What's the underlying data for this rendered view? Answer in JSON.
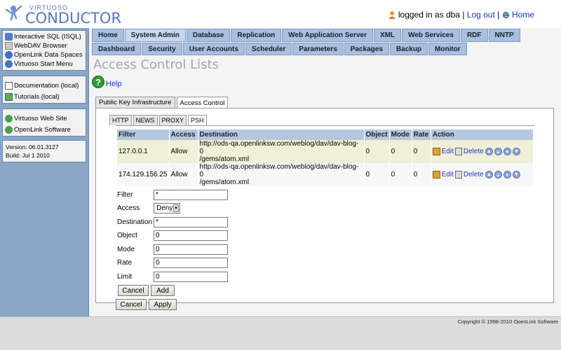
{
  "header": {
    "logo_small": "VIRTUOSO",
    "logo_big": "CONDUCTOR",
    "logged_in": "logged in as dba",
    "separator1": "|",
    "logout": "Log out",
    "separator2": "|",
    "home": "Home"
  },
  "sidebar": {
    "group1": [
      "Interactive SQL (ISQL)",
      "WebDAV Browser",
      "OpenLink Data Spaces",
      "Virtuoso Start Menu"
    ],
    "group2": [
      "Documentation (local)",
      "Tutorials (local)"
    ],
    "group3": [
      "Virtuoso Web Site",
      "OpenLink Software"
    ],
    "version": "Version: 06.01.3127",
    "build": "Build: Jul 1 2010"
  },
  "nav": {
    "tabs": [
      "Home",
      "System Admin",
      "Database",
      "Replication",
      "Web Application Server",
      "XML",
      "Web Services",
      "RDF",
      "NNTP"
    ],
    "active_tab": "System Admin",
    "subtabs": [
      "Dashboard",
      "Security",
      "User Accounts",
      "Scheduler",
      "Parameters",
      "Packages",
      "Backup",
      "Monitor"
    ],
    "active_subtab": "Security"
  },
  "page": {
    "title": "Access Control Lists",
    "help": "Help"
  },
  "outer_tabs": [
    "Public Key Infrastructure",
    "Access Control"
  ],
  "inner_tabs": [
    "HTTP",
    "NEWS",
    "PROXY",
    "PSH"
  ],
  "table": {
    "columns": [
      "Filter",
      "Access",
      "Destination",
      "Object",
      "Mode",
      "Rate",
      "Action"
    ],
    "rows": [
      {
        "filter": "127.0.0.1",
        "access": "Allow",
        "dest1": "http://ods-qa.openlinksw.com/weblog/dav/dav-blog-0",
        "dest2": "/gems/atom.xml",
        "object": "0",
        "mode": "0",
        "rate": "0",
        "edit": "Edit",
        "delete": "Delete"
      },
      {
        "filter": "174.129.156.25",
        "access": "Allow",
        "dest1": "http://ods-qa.openlinksw.com/weblog/dav/dav-blog-0",
        "dest2": "/gems/atom.xml",
        "object": "0",
        "mode": "0",
        "rate": "0",
        "edit": "Edit",
        "delete": "Delete"
      }
    ]
  },
  "form": {
    "filter_label": "Filter",
    "filter_value": "*",
    "access_label": "Access",
    "access_value": "Deny",
    "destination_label": "Destination",
    "destination_value": "*",
    "object_label": "Object",
    "object_value": "0",
    "mode_label": "Mode",
    "mode_value": "0",
    "rate_label": "Rate",
    "rate_value": "0",
    "limit_label": "Limit",
    "limit_value": "0",
    "cancel1": "Cancel",
    "add": "Add",
    "cancel2": "Cancel",
    "apply": "Apply"
  },
  "footer": {
    "copyright": "Copyright © 1998-2010 OpenLink Software"
  },
  "colors": {
    "sidebar_bg": "#8aa6c7",
    "tab_bg": "#a9bfdd",
    "table_header": "#b3c7e1",
    "row_highlight": "#f0f0d8",
    "link": "#1a36b0"
  }
}
